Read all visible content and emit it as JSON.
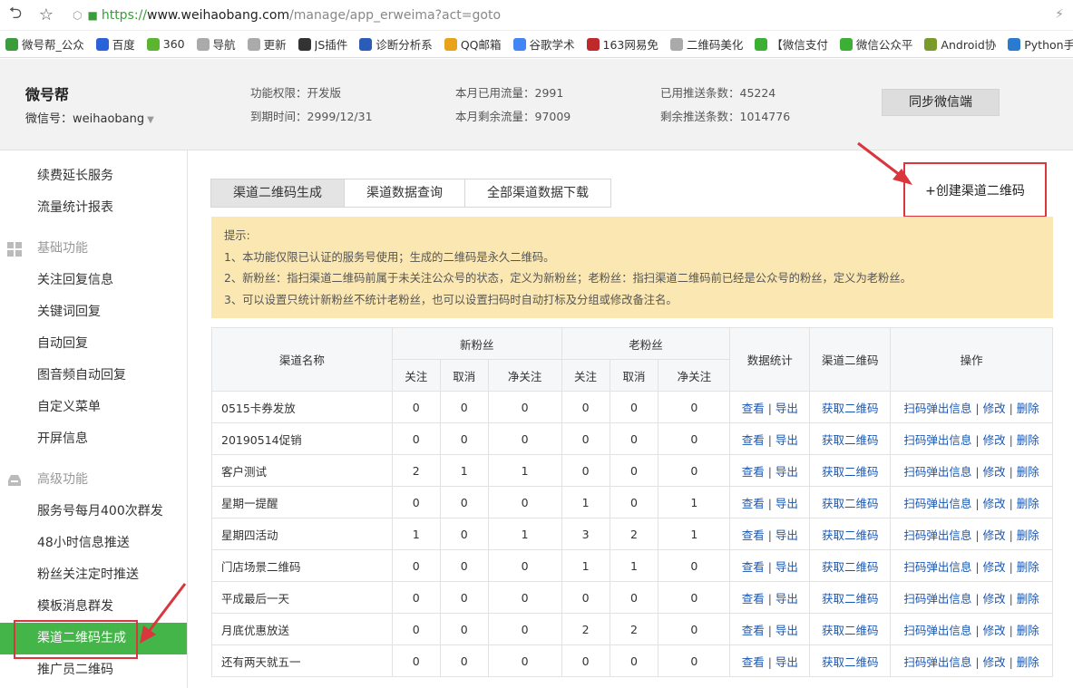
{
  "browser": {
    "url_proto": "https://",
    "url_host": "www.weihaobang.com",
    "url_path": "/manage/app_erweima?act=goto",
    "bookmarks": [
      {
        "label": "微号帮_公众",
        "color": "#3c9b3c"
      },
      {
        "label": "百度",
        "color": "#2a62d8"
      },
      {
        "label": "360",
        "color": "#5cb531"
      },
      {
        "label": "导航",
        "color": "#aaaaaa"
      },
      {
        "label": "更新",
        "color": "#aaaaaa"
      },
      {
        "label": "JS插件",
        "color": "#333333"
      },
      {
        "label": "诊断分析系",
        "color": "#2b5cb8"
      },
      {
        "label": "QQ邮箱",
        "color": "#e8a31b"
      },
      {
        "label": "谷歌学术",
        "color": "#4285f4"
      },
      {
        "label": "163网易免",
        "color": "#c0292c"
      },
      {
        "label": "二维码美化",
        "color": "#aaaaaa"
      },
      {
        "label": "【微信支付",
        "color": "#3cb034"
      },
      {
        "label": "微信公众平",
        "color": "#3cb034"
      },
      {
        "label": "Android协",
        "color": "#7a9b2a"
      },
      {
        "label": "Python手册",
        "color": "#2a7ad0"
      }
    ]
  },
  "account": {
    "name": "微号帮",
    "wxid": "微信号：weihaobang",
    "stats": {
      "perm": "功能权限：开发版",
      "expire": "到期时间：2999/12/31",
      "used": "本月已用流量：2991",
      "left": "本月剩余流量：97009",
      "pushed": "已用推送条数：45224",
      "remaining": "剩余推送条数：1014776"
    },
    "sync_label": "同步微信端"
  },
  "sidebar": {
    "items_top": [
      "续费延长服务",
      "流量统计报表"
    ],
    "group_basic": "基础功能",
    "items_basic": [
      "关注回复信息",
      "关键词回复",
      "自动回复",
      "图音频自动回复",
      "自定义菜单",
      "开屏信息"
    ],
    "group_adv": "高级功能",
    "items_adv": [
      "服务号每月400次群发",
      "48小时信息推送",
      "粉丝关注定时推送",
      "模板消息群发",
      "渠道二维码生成",
      "推广员二维码"
    ]
  },
  "tabs": [
    "渠道二维码生成",
    "渠道数据查询",
    "全部渠道数据下载"
  ],
  "create_label": "+创建渠道二维码",
  "tips": {
    "title": "提示:",
    "lines": [
      "1、本功能仅限已认证的服务号使用；生成的二维码是永久二维码。",
      "2、新粉丝：指扫渠道二维码前属于未关注公众号的状态，定义为新粉丝；老粉丝：指扫渠道二维码前已经是公众号的粉丝，定义为老粉丝。",
      "3、可以设置只统计新粉丝不统计老粉丝，也可以设置扫码时自动打标及分组或修改备注名。"
    ]
  },
  "table": {
    "h_channel": "渠道名称",
    "h_new": "新粉丝",
    "h_old": "老粉丝",
    "h_stats": "数据统计",
    "h_qr": "渠道二维码",
    "h_ops": "操作",
    "sub": {
      "follow": "关注",
      "cancel": "取消",
      "net": "净关注"
    },
    "links": {
      "view": "查看",
      "export": "导出",
      "get_qr": "获取二维码",
      "popup": "扫码弹出信息",
      "edit": "修改",
      "del": "删除",
      "sep": "|"
    },
    "rows": [
      {
        "name": "0515卡券发放",
        "n": [
          "0",
          "0",
          "0"
        ],
        "o": [
          "0",
          "0",
          "0"
        ]
      },
      {
        "name": "20190514促销",
        "n": [
          "0",
          "0",
          "0"
        ],
        "o": [
          "0",
          "0",
          "0"
        ]
      },
      {
        "name": "客户测试",
        "n": [
          "2",
          "1",
          "1"
        ],
        "o": [
          "0",
          "0",
          "0"
        ]
      },
      {
        "name": "星期一提醒",
        "n": [
          "0",
          "0",
          "0"
        ],
        "o": [
          "1",
          "0",
          "1"
        ]
      },
      {
        "name": "星期四活动",
        "n": [
          "1",
          "0",
          "1"
        ],
        "o": [
          "3",
          "2",
          "1"
        ]
      },
      {
        "name": "门店场景二维码",
        "n": [
          "0",
          "0",
          "0"
        ],
        "o": [
          "1",
          "1",
          "0"
        ]
      },
      {
        "name": "平成最后一天",
        "n": [
          "0",
          "0",
          "0"
        ],
        "o": [
          "0",
          "0",
          "0"
        ]
      },
      {
        "name": "月底优惠放送",
        "n": [
          "0",
          "0",
          "0"
        ],
        "o": [
          "2",
          "2",
          "0"
        ]
      },
      {
        "name": "还有两天就五一",
        "n": [
          "0",
          "0",
          "0"
        ],
        "o": [
          "0",
          "0",
          "0"
        ]
      }
    ]
  },
  "colors": {
    "accent_green": "#44b549",
    "link": "#1a57b3",
    "tips_bg": "#fbe7b1",
    "annotation_red": "#d9363e"
  }
}
